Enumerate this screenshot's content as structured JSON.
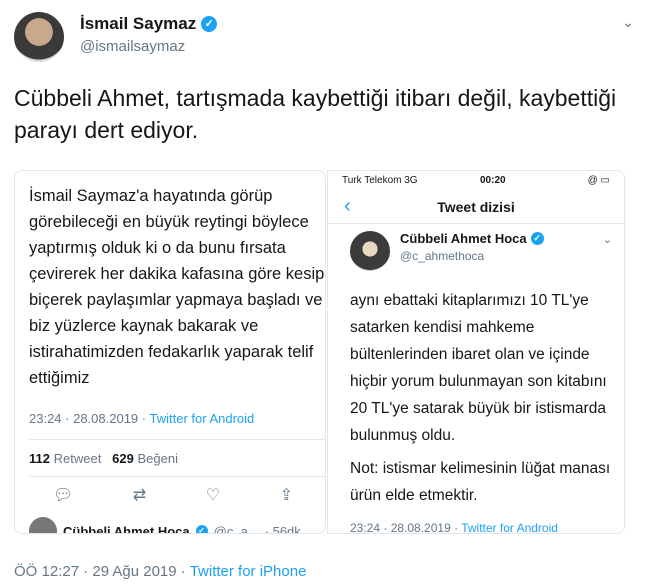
{
  "tweet": {
    "author_name": "İsmail Saymaz",
    "handle": "@ismailsaymaz",
    "text": "Cübbeli Ahmet, tartışmada kaybettiği itibarı değil, kaybettiği parayı dert ediyor.",
    "timestamp": "ÖÖ 12:27 · 29 Ağu 2019 ·",
    "source": "Twitter for iPhone",
    "icons": {
      "verified": "verified-icon",
      "caret": "chevron-down-icon"
    }
  },
  "left_screenshot": {
    "text": "İsmail Saymaz'a hayatında görüp görebileceği en büyük reytingi böylece yaptırmış olduk ki o da bunu fırsata çevirerek her dakika kafasına göre kesip biçerek paylaşımlar yapmaya başladı ve biz yüzlerce kaynak bakarak ve istirahatimizden fedakarlık yaparak telif ettiğimiz",
    "timestamp": "23:24 · 28.08.2019 ·",
    "source": "Twitter for Android",
    "retweet_count": "112",
    "retweet_label": "Retweet",
    "like_count": "629",
    "like_label": "Beğeni",
    "next_author": "Cübbeli Ahmet Hoca",
    "next_handle": "@c_a...",
    "next_age": "· 56dk",
    "actions": [
      "reply-icon",
      "retweet-icon",
      "like-icon",
      "share-icon"
    ]
  },
  "right_screenshot": {
    "carrier": "Turk Telekom  3G",
    "time": "00:20",
    "battery": "@ ▭",
    "header_title": "Tweet dizisi",
    "back": "‹",
    "author_name": "Cübbeli Ahmet Hoca",
    "handle": "@c_ahmethoca",
    "body": "aynı ebattaki kitaplarımızı 10 TL'ye satarken kendisi mahkeme bültenlerinden ibaret olan ve içinde hiçbir yorum bulunmayan son kitabını 20 TL'ye satarak büyük bir istismarda bulunmuş oldu.",
    "note": "Not: istismar kelimesinin lüğat manası ürün elde etmektir.",
    "timestamp": "23:24 · 28.08.2019 ·",
    "source": "Twitter for Android"
  },
  "colors": {
    "accent": "#1da1f2",
    "muted": "#657786",
    "text": "#14171a",
    "border": "#e1e8ed"
  }
}
